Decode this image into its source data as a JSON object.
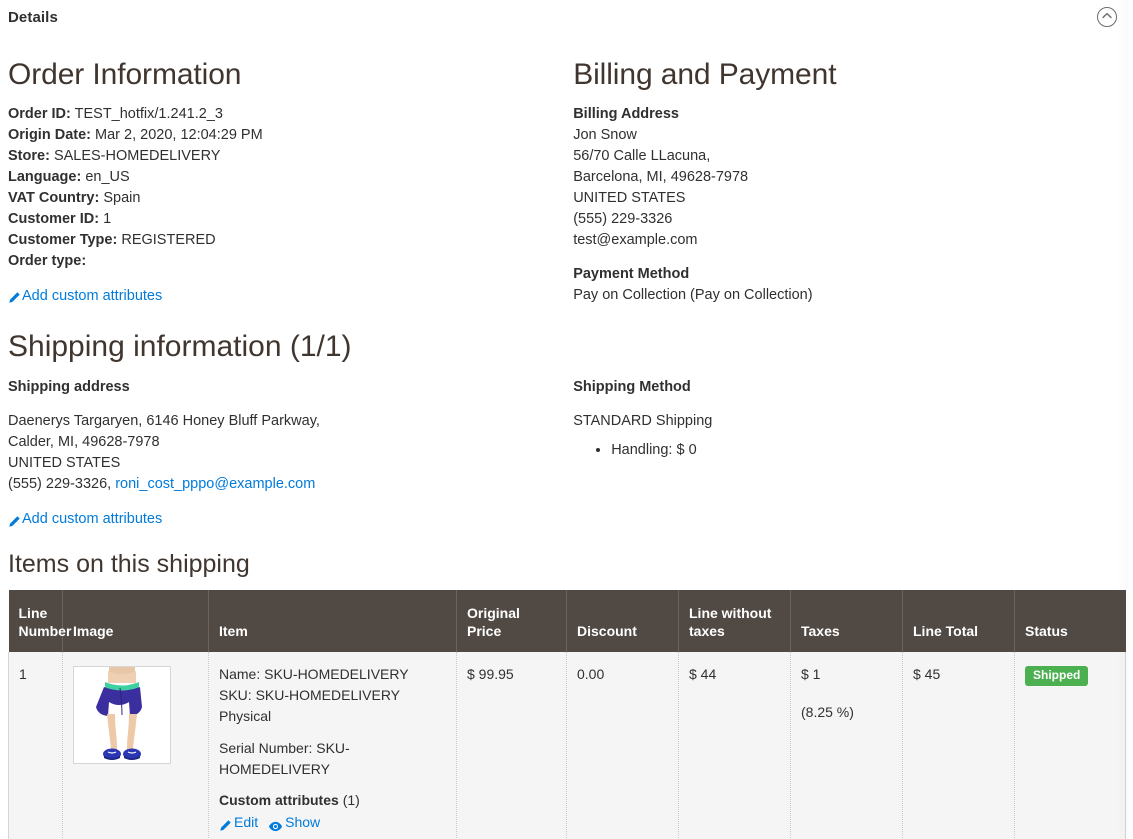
{
  "section": {
    "title": "Details",
    "collapse_icon": "chevron-up-circle-icon"
  },
  "order_information": {
    "heading": "Order Information",
    "fields": [
      {
        "label": "Order ID:",
        "value": "TEST_hotfix/1.241.2_3"
      },
      {
        "label": "Origin Date:",
        "value": "Mar 2, 2020, 12:04:29 PM"
      },
      {
        "label": "Store:",
        "value": "SALES-HOMEDELIVERY"
      },
      {
        "label": "Language:",
        "value": "en_US"
      },
      {
        "label": "VAT Country:",
        "value": "Spain"
      },
      {
        "label": "Customer ID:",
        "value": "1"
      },
      {
        "label": "Customer Type:",
        "value": "REGISTERED"
      },
      {
        "label": "Order type:",
        "value": ""
      }
    ],
    "add_custom_attributes": "Add custom attributes",
    "add_custom_attributes_icon": "pencil-icon"
  },
  "billing_and_payment": {
    "heading": "Billing and Payment",
    "billing_address_label": "Billing Address",
    "billing_address_lines": [
      "Jon Snow",
      "56/70 Calle LLacuna,",
      "Barcelona, MI, 49628-7978",
      "UNITED STATES",
      "(555) 229-3326",
      "test@example.com"
    ],
    "payment_method_label": "Payment Method",
    "payment_method_value": "Pay on Collection (Pay on Collection)"
  },
  "shipping": {
    "heading": "Shipping information (1/1)",
    "address_label": "Shipping address",
    "address_lines": [
      "Daenerys Targaryen, 6146 Honey Bluff Parkway,",
      "Calder, MI, 49628-7978",
      "UNITED STATES"
    ],
    "phone": "(555) 229-3326,",
    "email": "roni_cost_pppo@example.com",
    "add_custom_attributes": "Add custom attributes",
    "add_custom_attributes_icon": "pencil-icon",
    "method_label": "Shipping Method",
    "method_value": "STANDARD Shipping",
    "method_bullets": [
      "Handling: $ 0"
    ]
  },
  "items_table": {
    "heading": "Items on this shipping",
    "columns": [
      "Line Number",
      "Image",
      "Item",
      "Original Price",
      "Discount",
      "Line without taxes",
      "Taxes",
      "Line Total",
      "Status"
    ],
    "rows": [
      {
        "line_number": "1",
        "image_alt": "product-thumbnail-athletic-shorts",
        "item": {
          "name": "Name: SKU-HOMEDELIVERY",
          "sku": "SKU: SKU-HOMEDELIVERY",
          "type": "Physical",
          "serial_number": "Serial Number: SKU-HOMEDELIVERY",
          "custom_attributes_label": "Custom attributes",
          "custom_attributes_count": "(1)",
          "edit_label": "Edit",
          "edit_icon": "pencil-icon",
          "show_label": "Show",
          "show_icon": "eye-icon"
        },
        "original_price": "$ 99.95",
        "discount": "0.00",
        "line_without_taxes": "$ 44",
        "taxes": "$ 1",
        "taxes_percent": "(8.25 %)",
        "line_total": "$ 45",
        "status": "Shipped"
      }
    ]
  },
  "colors": {
    "table_header_bg": "#514943",
    "row_bg": "#f5f5f5",
    "link": "#007bdb",
    "status_badge_green": "#4caf50",
    "heading_text": "#41362f"
  }
}
